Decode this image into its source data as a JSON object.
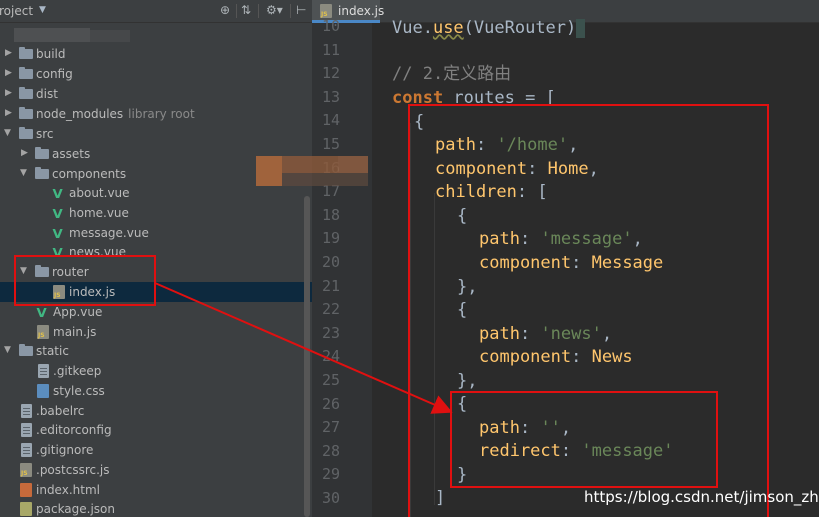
{
  "panel": {
    "title": "roject",
    "icons": [
      "target-icon",
      "collapse-icon",
      "settings-icon",
      "hide-icon"
    ]
  },
  "tree": {
    "build": "build",
    "config": "config",
    "dist": "dist",
    "node_modules": "node_modules",
    "node_modules_hint": "library root",
    "src": "src",
    "assets": "assets",
    "components": "components",
    "about": "about.vue",
    "home": "home.vue",
    "message": "message.vue",
    "news": "news.vue",
    "router": "router",
    "index": "index.js",
    "app": "App.vue",
    "main": "main.js",
    "static": "static",
    "gitkeep": ".gitkeep",
    "stylecss": "style.css",
    "babelrc": ".babelrc",
    "editorconfig": ".editorconfig",
    "gitignore": ".gitignore",
    "postcssrc": ".postcssrc.js",
    "indexhtml": "index.html",
    "packagejson": "package.json"
  },
  "editor": {
    "tab": "index.js",
    "line_numbers": [
      "10",
      "11",
      "12",
      "13",
      "14",
      "15",
      "16",
      "17",
      "18",
      "19",
      "20",
      "21",
      "22",
      "23",
      "24",
      "25",
      "26",
      "27",
      "28",
      "29",
      "30"
    ],
    "code": {
      "l10_ident": "Vue.",
      "l10_method": "use",
      "l10_rest": "(VueRouter)",
      "l12_comment": "// 2.定义路由",
      "l13_kw": "const",
      "l13_rest": " routes = [",
      "brace_open": "{",
      "path_key": "path",
      "colon": ": ",
      "comma": ",",
      "home_path": "'/home'",
      "component_key": "component",
      "home_comp": "Home",
      "children_key": "children",
      "bracket_open": "[",
      "message_path": "'message'",
      "message_comp": "Message",
      "brace_close_comma": "},",
      "news_path": "'news'",
      "news_comp": "News",
      "empty_path": "''",
      "redirect_key": "redirect",
      "redirect_val": "'message'",
      "brace_close": "}",
      "bracket_close": "]"
    }
  },
  "watermark": "https://blog.csdn.net/jimson_zhu",
  "colors": {
    "annotation": "#e01010",
    "selection": "#0d293e",
    "vue_green": "#41b883"
  }
}
